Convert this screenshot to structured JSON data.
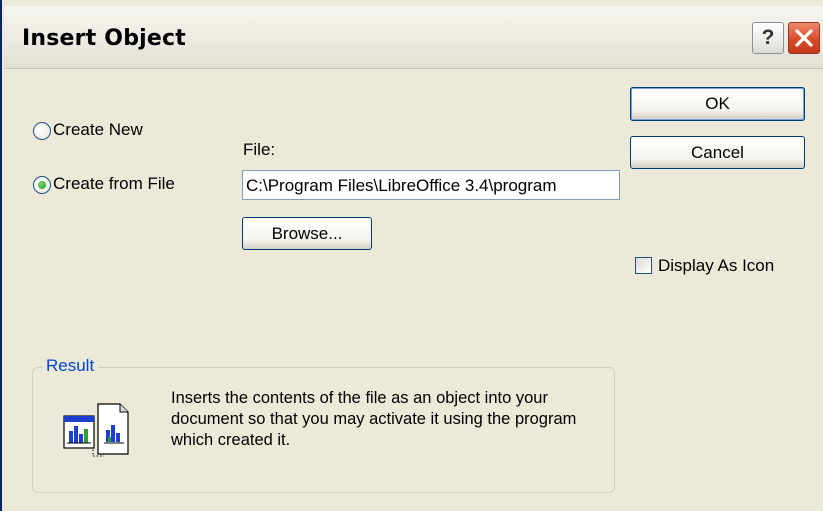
{
  "window": {
    "title": "Insert Object"
  },
  "titlebar_buttons": {
    "help_label": "?",
    "close_icon": "close-icon"
  },
  "options": {
    "create_new_label": "Create New",
    "create_from_file_label": "Create from File",
    "selected": "create_from_file"
  },
  "file": {
    "label": "File:",
    "value": "C:\\Program Files\\LibreOffice 3.4\\program",
    "browse_label": "Browse..."
  },
  "buttons": {
    "ok_label": "OK",
    "cancel_label": "Cancel"
  },
  "display_as_icon": {
    "label": "Display As Icon",
    "checked": false
  },
  "result": {
    "legend": "Result",
    "description": "Inserts the contents of the file as an object into your document so that you may activate it using the program which created it.",
    "icon": "insert-file-object-icon"
  },
  "colors": {
    "dialog_bg": "#ece9d8",
    "accent_blue": "#0046d5",
    "close_red": "#d94a2a",
    "radio_green": "#21a121"
  }
}
